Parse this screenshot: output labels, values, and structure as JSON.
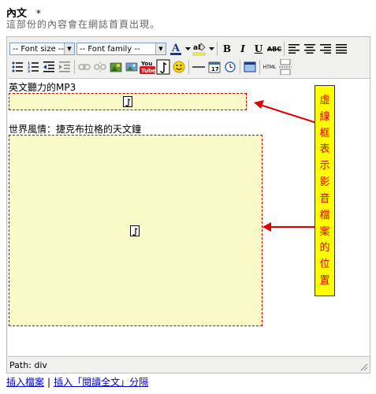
{
  "field": {
    "label": "內文",
    "required_mark": "*",
    "help_text": "這部份的內容會在網誌首頁出現。"
  },
  "toolbar": {
    "font_size": "-- Font size --",
    "font_family": "-- Font family --",
    "bold_label": "B",
    "italic_label": "I",
    "underline_label": "U",
    "strike_label": "ABC",
    "youtube_label": "YouTube",
    "html_label": "HTML",
    "row1_icons": [
      "forecolor-icon",
      "backcolor-icon",
      "bold-icon",
      "italic-icon",
      "underline-icon",
      "strikethrough-icon",
      "align-left-icon",
      "align-center-icon",
      "align-right-icon",
      "align-justify-icon"
    ],
    "row2_icons": [
      "bullet-list-icon",
      "numbered-list-icon",
      "outdent-icon",
      "indent-icon",
      "link-icon",
      "unlink-icon",
      "image-upload-icon",
      "image-icon",
      "youtube-icon",
      "media-icon",
      "emoticon-icon",
      "horizontal-rule-icon",
      "insert-date-icon",
      "insert-time-icon",
      "fullscreen-icon",
      "html-source-icon",
      "page-break-icon"
    ]
  },
  "content": {
    "mp3_title": "英文聽力的MP3",
    "movie_title": "世界風情：捷克布拉格的天文鐘"
  },
  "annotation": {
    "text": "虛線框表示影音檔案的位置",
    "color": "#e00000",
    "background": "#ffff00"
  },
  "status": {
    "path": "Path: div"
  },
  "links": {
    "insert_file": "插入檔案",
    "separator": "|",
    "insert_more": "插入「閱讀全文」分隔"
  }
}
